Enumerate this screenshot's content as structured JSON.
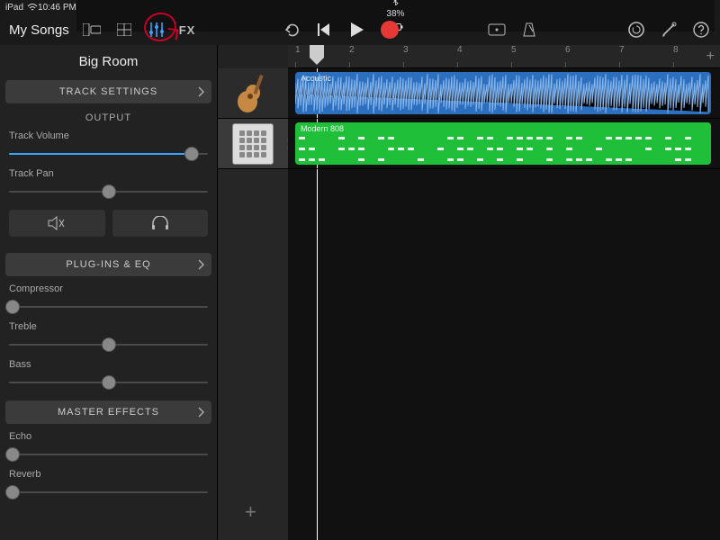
{
  "status": {
    "device": "iPad",
    "time": "10:46 PM",
    "battery": "38%"
  },
  "toolbar": {
    "back_label": "My Songs",
    "fx_label": "FX"
  },
  "song": {
    "title": "Big Room"
  },
  "sections": {
    "track_settings": "TRACK SETTINGS",
    "output": "OUTPUT",
    "plugins_eq": "PLUG-INS & EQ",
    "master_effects": "MASTER EFFECTS"
  },
  "params": {
    "track_volume": {
      "label": "Track Volume",
      "value": 0.92
    },
    "track_pan": {
      "label": "Track Pan",
      "value": 0.5
    },
    "compressor": {
      "label": "Compressor",
      "value": 0.02
    },
    "treble": {
      "label": "Treble",
      "value": 0.5
    },
    "bass": {
      "label": "Bass",
      "value": 0.5
    },
    "echo": {
      "label": "Echo",
      "value": 0.02
    },
    "reverb": {
      "label": "Reverb",
      "value": 0.02
    }
  },
  "timeline": {
    "bars": [
      1,
      2,
      3,
      4,
      5,
      6,
      7,
      8
    ],
    "playhead_bar": 1.4
  },
  "tracks": [
    {
      "instrument": "guitar",
      "region_name": "Acoustic",
      "region_type": "audio",
      "start": 1,
      "end": 8.7
    },
    {
      "instrument": "sampler",
      "region_name": "Modern 808",
      "region_type": "midi",
      "start": 1,
      "end": 8.7
    }
  ]
}
